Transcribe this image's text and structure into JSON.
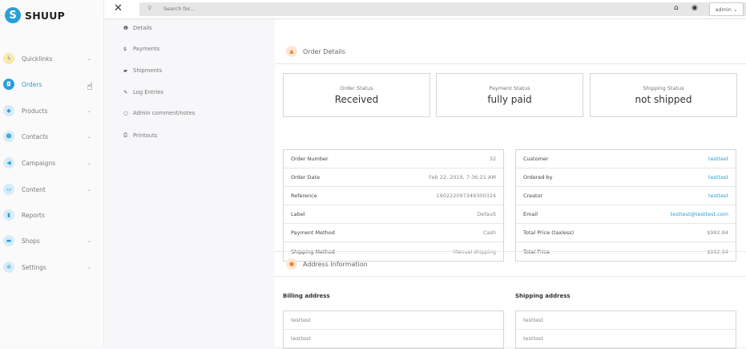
{
  "brand": {
    "name": "SHUUP",
    "logo_letter": "S"
  },
  "sidebar": {
    "items": [
      {
        "label": "Quicklinks",
        "icon": "bolt-icon",
        "color": "#fce9a6",
        "has_chevron": true
      },
      {
        "label": "Orders",
        "icon": "orders-icon",
        "color": "#2a9fd8",
        "has_chevron": true,
        "active": true
      },
      {
        "label": "Products",
        "icon": "cube-icon",
        "color": "#d7ecf8",
        "has_chevron": true
      },
      {
        "label": "Contacts",
        "icon": "users-icon",
        "color": "#d7ecf8",
        "has_chevron": true
      },
      {
        "label": "Campaigns",
        "icon": "bullhorn-icon",
        "color": "#d7ecf8",
        "has_chevron": true
      },
      {
        "label": "Content",
        "icon": "content-icon",
        "color": "#d7ecf8",
        "has_chevron": true
      },
      {
        "label": "Reports",
        "icon": "chart-icon",
        "color": "#d7ecf8",
        "has_chevron": false
      },
      {
        "label": "Shops",
        "icon": "shop-icon",
        "color": "#d7ecf8",
        "has_chevron": true
      },
      {
        "label": "Settings",
        "icon": "gears-icon",
        "color": "#d7ecf8",
        "has_chevron": true
      }
    ]
  },
  "topbar": {
    "search_placeholder": "Search for...",
    "user_label": "admin ⌄"
  },
  "subnav": {
    "items": [
      {
        "label": "Details",
        "icon": "info-icon",
        "glyph": "❶"
      },
      {
        "label": "Payments",
        "icon": "dollar-icon",
        "glyph": "$"
      },
      {
        "label": "Shipments",
        "icon": "truck-icon",
        "glyph": "▰"
      },
      {
        "label": "Log Entries",
        "icon": "pencil-icon",
        "glyph": "✎"
      },
      {
        "label": "Admin comment/notes",
        "icon": "comment-icon",
        "glyph": "○"
      },
      {
        "label": "Printouts",
        "icon": "print-icon",
        "glyph": "⎙"
      }
    ]
  },
  "order_details": {
    "title": "Order Details",
    "statuses": [
      {
        "label": "Order Status",
        "value": "Received"
      },
      {
        "label": "Payment Status",
        "value": "fully paid"
      },
      {
        "label": "Shipping Status",
        "value": "not shipped"
      }
    ],
    "left_table": [
      {
        "key": "Order Number",
        "value": "32"
      },
      {
        "key": "Order Date",
        "value": "Feb 22, 2019, 7:36:21 AM"
      },
      {
        "key": "Reference",
        "value": "190222097349300324"
      },
      {
        "key": "Label",
        "value": "Default"
      },
      {
        "key": "Payment Method",
        "value": "Cash"
      },
      {
        "key": "Shipping Method",
        "value": "Manual shipping"
      }
    ],
    "right_table": [
      {
        "key": "Customer",
        "value": "testtest",
        "link": true
      },
      {
        "key": "Ordered by",
        "value": "testtest",
        "link": true
      },
      {
        "key": "Creator",
        "value": "testtest",
        "link": true
      },
      {
        "key": "Email",
        "value": "testtest@testtest.com",
        "link": true
      },
      {
        "key": "Total Price (taxless)",
        "value": "$992.84",
        "link": false
      },
      {
        "key": "Total Price",
        "value": "$992.84",
        "link": false
      }
    ]
  },
  "address_info": {
    "title": "Address Information",
    "billing_title": "Billing address",
    "shipping_title": "Shipping address",
    "billing_lines": [
      "testtest",
      "testtest"
    ],
    "shipping_lines": [
      "testtest",
      "testtest"
    ]
  }
}
